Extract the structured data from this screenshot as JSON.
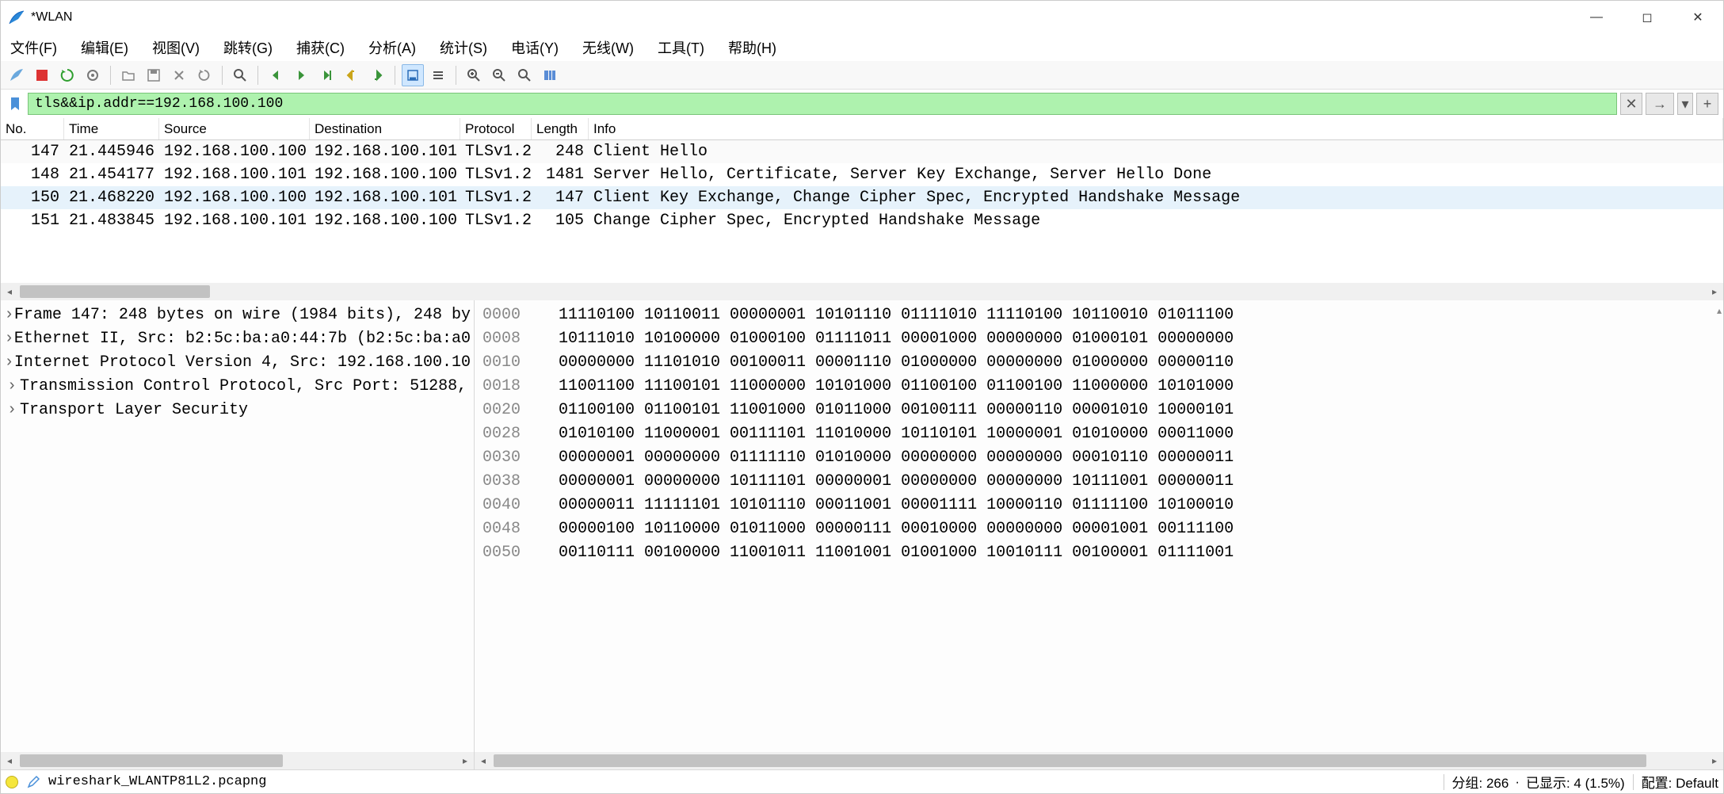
{
  "title": "*WLAN",
  "menu": {
    "file": "文件(F)",
    "edit": "编辑(E)",
    "view": "视图(V)",
    "go": "跳转(G)",
    "capture": "捕获(C)",
    "analyze": "分析(A)",
    "stats": "统计(S)",
    "telephony": "电话(Y)",
    "wireless": "无线(W)",
    "tools": "工具(T)",
    "help": "帮助(H)"
  },
  "filter": {
    "value": "tls&&ip.addr==192.168.100.100"
  },
  "columns": {
    "no": "No.",
    "time": "Time",
    "src": "Source",
    "dst": "Destination",
    "proto": "Protocol",
    "len": "Length",
    "info": "Info"
  },
  "packets": [
    {
      "no": "147",
      "time": "21.445946",
      "src": "192.168.100.100",
      "dst": "192.168.100.101",
      "proto": "TLSv1.2",
      "len": "248",
      "info": "Client Hello",
      "sel": false,
      "alt": true
    },
    {
      "no": "148",
      "time": "21.454177",
      "src": "192.168.100.101",
      "dst": "192.168.100.100",
      "proto": "TLSv1.2",
      "len": "1481",
      "info": "Server Hello, Certificate, Server Key Exchange, Server Hello Done",
      "sel": false,
      "alt": false
    },
    {
      "no": "150",
      "time": "21.468220",
      "src": "192.168.100.100",
      "dst": "192.168.100.101",
      "proto": "TLSv1.2",
      "len": "147",
      "info": "Client Key Exchange, Change Cipher Spec, Encrypted Handshake Message",
      "sel": true,
      "alt": false
    },
    {
      "no": "151",
      "time": "21.483845",
      "src": "192.168.100.101",
      "dst": "192.168.100.100",
      "proto": "TLSv1.2",
      "len": "105",
      "info": "Change Cipher Spec, Encrypted Handshake Message",
      "sel": false,
      "alt": false
    }
  ],
  "tree": [
    "Frame 147: 248 bytes on wire (1984 bits), 248 by",
    "Ethernet II, Src: b2:5c:ba:a0:44:7b (b2:5c:ba:a0",
    "Internet Protocol Version 4, Src: 192.168.100.10",
    "Transmission Control Protocol, Src Port: 51288,",
    "Transport Layer Security"
  ],
  "hex": [
    {
      "a": "0000",
      "b": "11110100 10110011 00000001 10101110 01111010 11110100 10110010 01011100"
    },
    {
      "a": "0008",
      "b": "10111010 10100000 01000100 01111011 00001000 00000000 01000101 00000000"
    },
    {
      "a": "0010",
      "b": "00000000 11101010 00100011 00001110 01000000 00000000 01000000 00000110"
    },
    {
      "a": "0018",
      "b": "11001100 11100101 11000000 10101000 01100100 01100100 11000000 10101000"
    },
    {
      "a": "0020",
      "b": "01100100 01100101 11001000 01011000 00100111 00000110 00001010 10000101"
    },
    {
      "a": "0028",
      "b": "01010100 11000001 00111101 11010000 10110101 10000001 01010000 00011000"
    },
    {
      "a": "0030",
      "b": "00000001 00000000 01111110 01010000 00000000 00000000 00010110 00000011"
    },
    {
      "a": "0038",
      "b": "00000001 00000000 10111101 00000001 00000000 00000000 10111001 00000011"
    },
    {
      "a": "0040",
      "b": "00000011 11111101 10101110 00011001 00001111 10000110 01111100 10100010"
    },
    {
      "a": "0048",
      "b": "00000100 10110000 01011000 00000111 00010000 00000000 00001001 00111100"
    },
    {
      "a": "0050",
      "b": "00110111 00100000 11001011 11001001 01001000 10010111 00100001 01111001"
    }
  ],
  "status": {
    "file": "wireshark_WLANTP81L2.pcapng",
    "packets": "分组: 266 ",
    "displayed": " 已显示: 4 (1.5%)",
    "profile": "配置: Default"
  }
}
